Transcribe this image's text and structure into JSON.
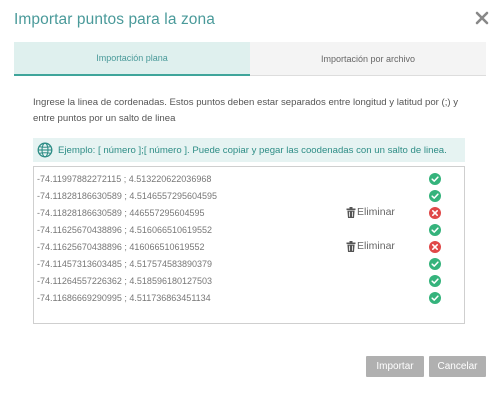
{
  "dialog": {
    "title": "Importar puntos para la zona"
  },
  "tabs": [
    {
      "label": "Importación plana",
      "active": true
    },
    {
      "label": "Importación por archivo",
      "active": false
    }
  ],
  "instructions": "Ingrese la linea de cordenadas. Estos puntos deben estar separados entre longitud y latitud por (;) y entre puntos por un salto de linea",
  "example": {
    "icon": "globe-icon",
    "text": "Ejemplo: [ número ];[ número ]. Puede copiar y pegar las coodenadas con un salto de linea."
  },
  "coordinates": [
    {
      "text": "-74.11997882272115 ; 4.513220622036968",
      "valid": true,
      "delete_label": ""
    },
    {
      "text": "-74.11828186630589 ; 4.5146557295604595",
      "valid": true,
      "delete_label": ""
    },
    {
      "text": "-74.11828186630589 ; 446557295604595",
      "valid": false,
      "delete_label": "Eliminar"
    },
    {
      "text": "-74.11625670438896 ; 4.516066510619552",
      "valid": true,
      "delete_label": ""
    },
    {
      "text": "-74.11625670438896 ; 416066510619552",
      "valid": false,
      "delete_label": "Eliminar"
    },
    {
      "text": "-74.11457313603485 ; 4.517574583890379",
      "valid": true,
      "delete_label": ""
    },
    {
      "text": "-74.11264557226362 ; 4.518596180127503",
      "valid": true,
      "delete_label": ""
    },
    {
      "text": "-74.11686669290995 ; 4.511736863451134",
      "valid": true,
      "delete_label": ""
    }
  ],
  "buttons": {
    "import_label": "Importar",
    "cancel_label": "Cancelar"
  },
  "colors": {
    "accent": "#4a9a9a",
    "valid": "#35b37c",
    "invalid": "#e04848",
    "button_disabled": "#b0b0b0"
  }
}
